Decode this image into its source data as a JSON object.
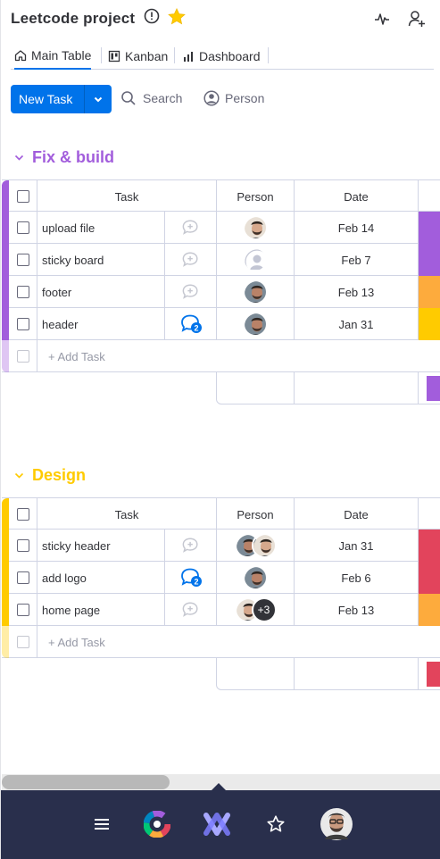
{
  "header": {
    "title": "Leetcode project",
    "accent_star": "#ffcb00"
  },
  "tabs": [
    {
      "label": "Main Table",
      "icon": "home-icon",
      "active": true
    },
    {
      "label": "Kanban",
      "icon": "kanban-icon",
      "active": false
    },
    {
      "label": "Dashboard",
      "icon": "chart-icon",
      "active": false
    }
  ],
  "toolbar": {
    "new_task_label": "New Task",
    "search_label": "Search",
    "person_label": "Person",
    "primary_color": "#0073ea"
  },
  "columns": {
    "task": "Task",
    "person": "Person",
    "date": "Date"
  },
  "add_task_label": "+ Add Task",
  "groups": [
    {
      "title": "Fix & build",
      "color": "#a25ddc",
      "rows": [
        {
          "name": "upload file",
          "comments": "",
          "people": [
            "avatar-a"
          ],
          "extra": "",
          "date": "Feb 14",
          "status_color": "#a25ddc"
        },
        {
          "name": "sticky board",
          "comments": "",
          "people": [
            "empty"
          ],
          "extra": "",
          "date": "Feb 7",
          "status_color": "#a25ddc"
        },
        {
          "name": "footer",
          "comments": "",
          "people": [
            "avatar-b"
          ],
          "extra": "",
          "date": "Feb 13",
          "status_color": "#fdab3d"
        },
        {
          "name": "header",
          "comments": "2",
          "people": [
            "avatar-b"
          ],
          "extra": "",
          "date": "Jan 31",
          "status_color": "#ffcb00"
        }
      ],
      "summary_color": "#a25ddc"
    },
    {
      "title": "Design",
      "color": "#ffcb00",
      "rows": [
        {
          "name": "sticky header",
          "comments": "",
          "people": [
            "avatar-b",
            "avatar-a"
          ],
          "extra": "",
          "date": "Jan 31",
          "status_color": "#e2445c"
        },
        {
          "name": "add logo",
          "comments": "2",
          "people": [
            "avatar-b"
          ],
          "extra": "",
          "date": "Feb 6",
          "status_color": "#e2445c"
        },
        {
          "name": "home page",
          "comments": "",
          "people": [
            "avatar-a"
          ],
          "extra": "+3",
          "date": "Feb 13",
          "status_color": "#fdab3d"
        }
      ],
      "summary_color": "#e2445c"
    }
  ],
  "bottom_nav": [
    "menu-icon",
    "apps-icon",
    "monday-logo-icon",
    "favorites-star-icon",
    "user-avatar"
  ]
}
